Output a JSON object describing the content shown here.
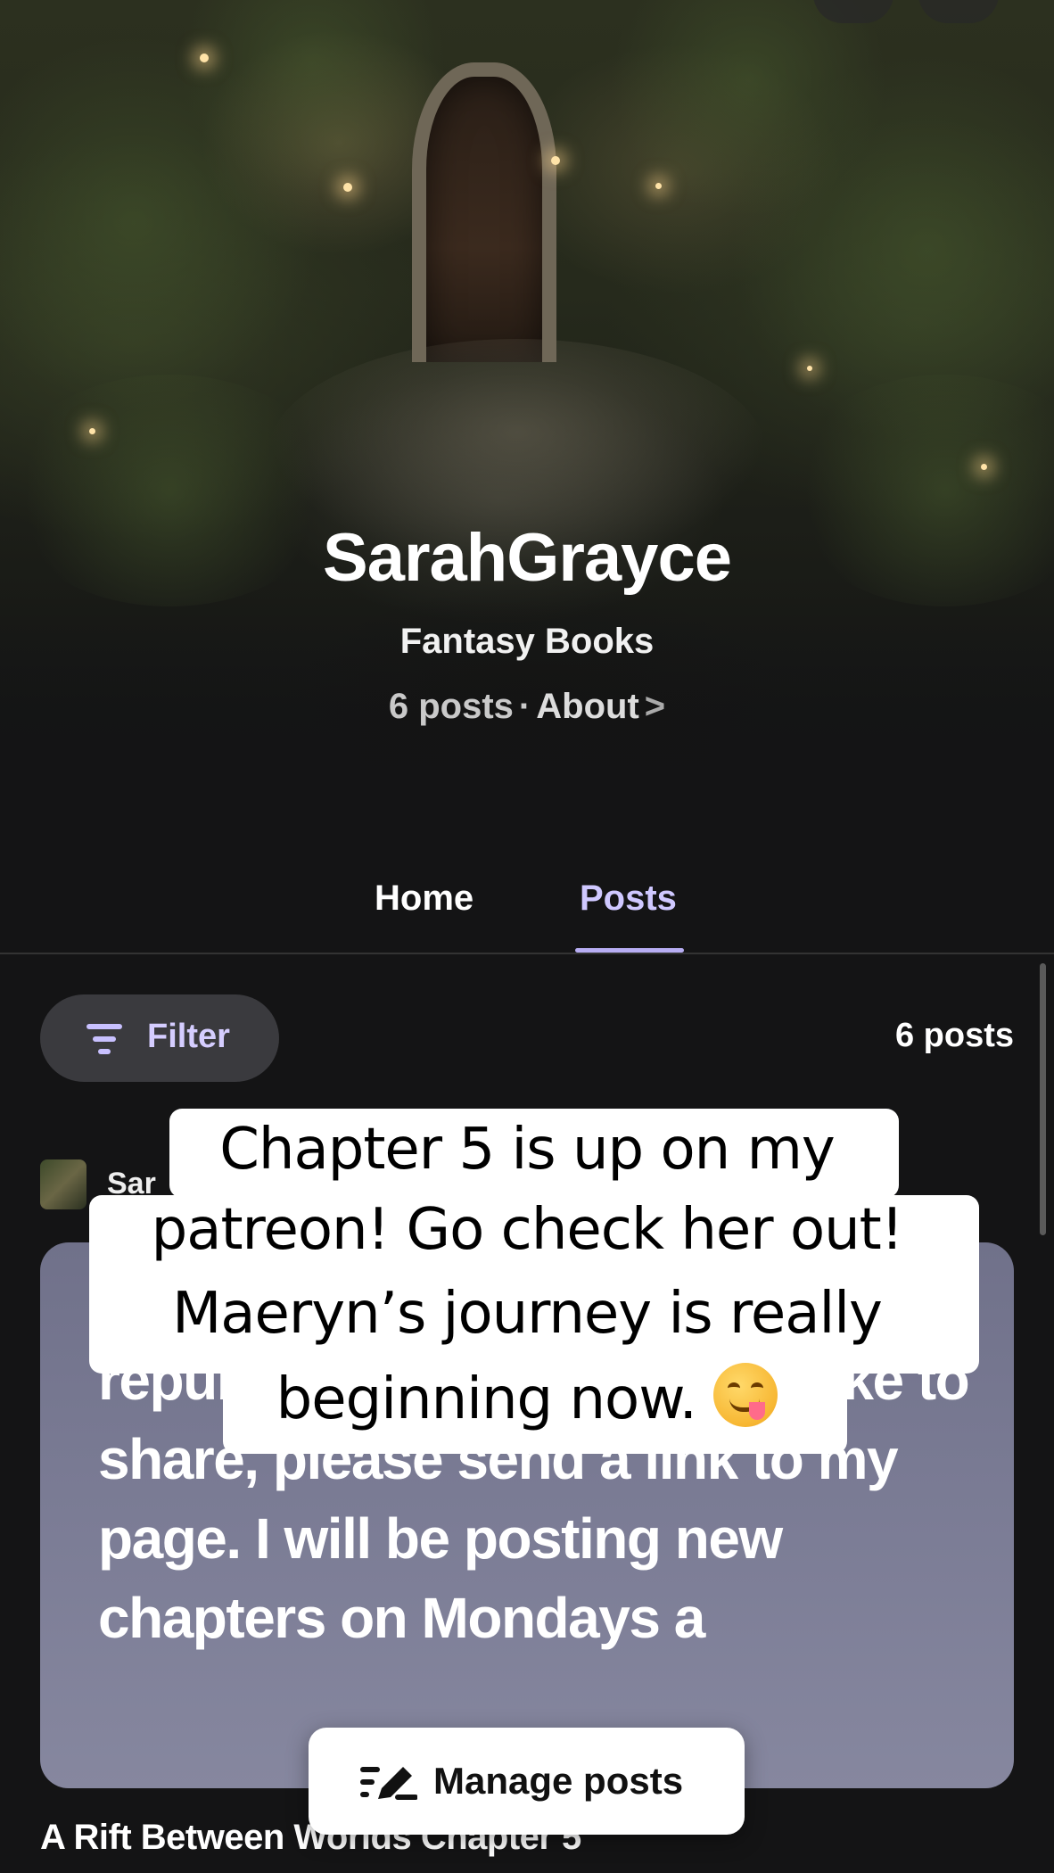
{
  "profile": {
    "name": "SarahGrayce",
    "category": "Fantasy Books",
    "posts_count_text": "6 posts",
    "separator": "·",
    "about_label": "About",
    "about_chevron": ">"
  },
  "tabs": [
    {
      "label": "Home",
      "active": false
    },
    {
      "label": "Posts",
      "active": true
    }
  ],
  "filter": {
    "label": "Filter",
    "icon": "filter-icon",
    "results_count": "6 posts"
  },
  "post": {
    "author_partial": "Sar",
    "excerpt": "republish my work. If you'd like to share, please send a link to my page.  I will be posting new chapters on Mondays a",
    "title": "A Rift Between Worlds Chapter 5"
  },
  "manage_posts": {
    "label": "Manage posts",
    "icon": "edit-list-icon"
  },
  "caption_overlay": {
    "lines": [
      "Chapter 5 is up on my",
      "patreon! Go check her out!",
      "Maeryn’s journey is really",
      "beginning now."
    ],
    "emoji": "face-savoring-food-emoji"
  },
  "colors": {
    "background": "#141415",
    "accent": "#cfc8ff",
    "card": "#7b7c95"
  }
}
